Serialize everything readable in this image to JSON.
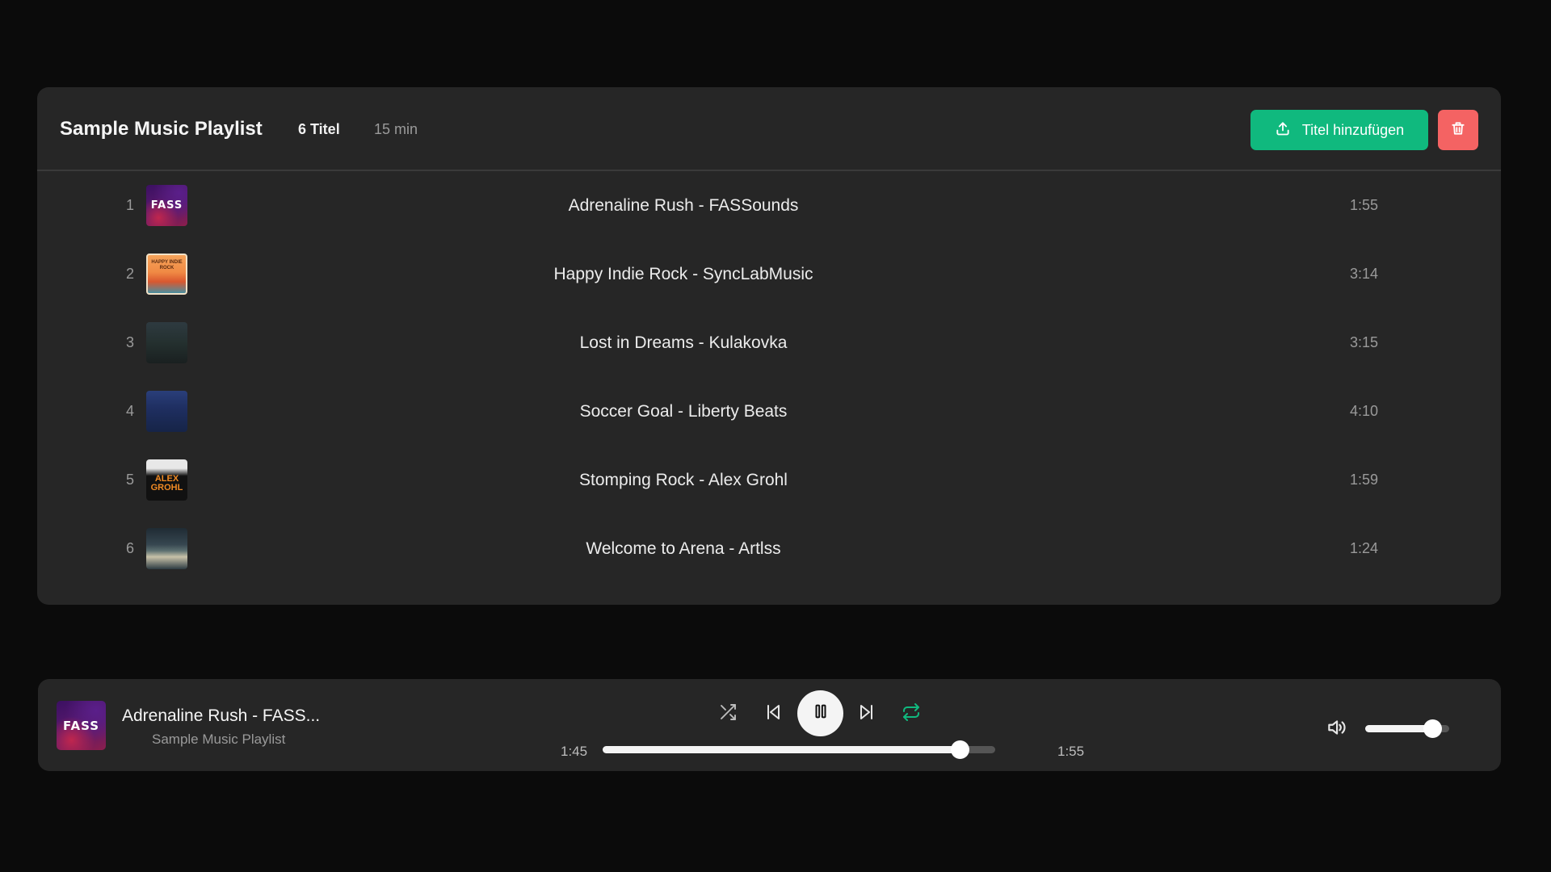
{
  "playlist": {
    "title": "Sample Music Playlist",
    "track_count": "6 Titel",
    "total_duration": "15 min",
    "add_button_label": "Titel hinzufügen",
    "add_icon": "upload-icon",
    "delete_icon": "trash-icon",
    "tracks": [
      {
        "number": "1",
        "title": "Adrenaline Rush - FASSounds",
        "duration": "1:55",
        "cover_text": "FASS"
      },
      {
        "number": "2",
        "title": "Happy Indie Rock - SyncLabMusic",
        "duration": "3:14",
        "cover_text": "HAPPY INDIE ROCK"
      },
      {
        "number": "3",
        "title": "Lost in Dreams - Kulakovka",
        "duration": "3:15"
      },
      {
        "number": "4",
        "title": "Soccer Goal - Liberty Beats",
        "duration": "4:10"
      },
      {
        "number": "5",
        "title": "Stomping Rock - Alex Grohl",
        "duration": "1:59",
        "cover_text": "ALEX GROHL"
      },
      {
        "number": "6",
        "title": "Welcome to Arena - Artlss",
        "duration": "1:24"
      }
    ]
  },
  "player": {
    "now_playing_title": "Adrenaline Rush - FASS...",
    "now_playing_playlist": "Sample Music Playlist",
    "cover_text": "FASS",
    "current_time": "1:45",
    "total_time": "1:55",
    "progress_fraction": 0.91,
    "volume_fraction": 0.8,
    "icons": {
      "shuffle": "shuffle-icon",
      "previous": "skip-back-icon",
      "play_pause": "pause-icon",
      "next": "skip-forward-icon",
      "repeat": "repeat-icon",
      "volume": "volume-icon"
    },
    "repeat_active": true
  },
  "colors": {
    "accent": "#10b97e",
    "danger": "#f46363",
    "background": "#0b0b0b",
    "card": "#262626"
  }
}
